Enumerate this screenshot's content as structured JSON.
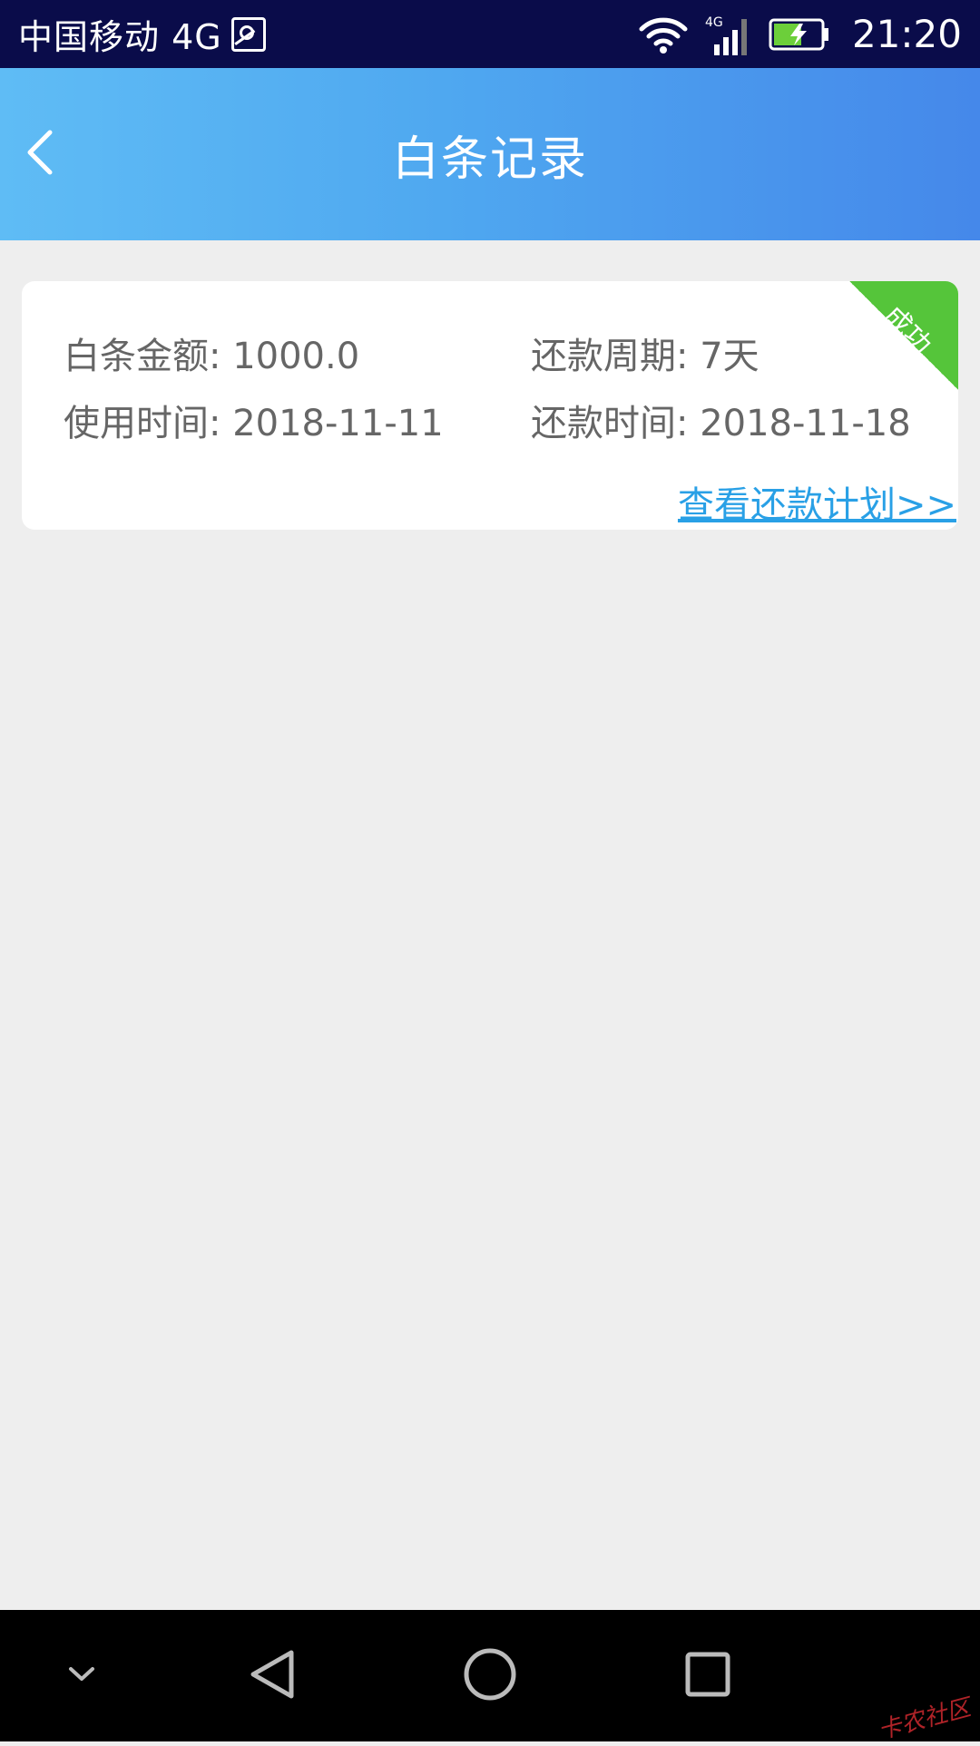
{
  "status_bar": {
    "carrier": "中国移动 4G",
    "network_type": "4G",
    "time": "21:20",
    "icons": [
      "gallery-icon",
      "wifi-icon",
      "signal-icon",
      "battery-icon"
    ]
  },
  "header": {
    "title": "白条记录",
    "back_icon": "chevron-left-icon",
    "gradient_start": "#5fbcf5",
    "gradient_end": "#4588ea"
  },
  "record": {
    "status": "成功",
    "status_color": "#55c53a",
    "amount": "白条金额: 1000.0",
    "period": "还款周期: 7天",
    "use_time": "使用时间: 2018-11-11",
    "repay_time": "还款时间: 2018-11-18",
    "plan_link": "查看还款计划>>",
    "link_color": "#29a0e6"
  },
  "nav_bar": {
    "icons": [
      "collapse-icon",
      "back-triangle-icon",
      "home-circle-icon",
      "recents-square-icon"
    ]
  },
  "watermark": "卡农社区"
}
